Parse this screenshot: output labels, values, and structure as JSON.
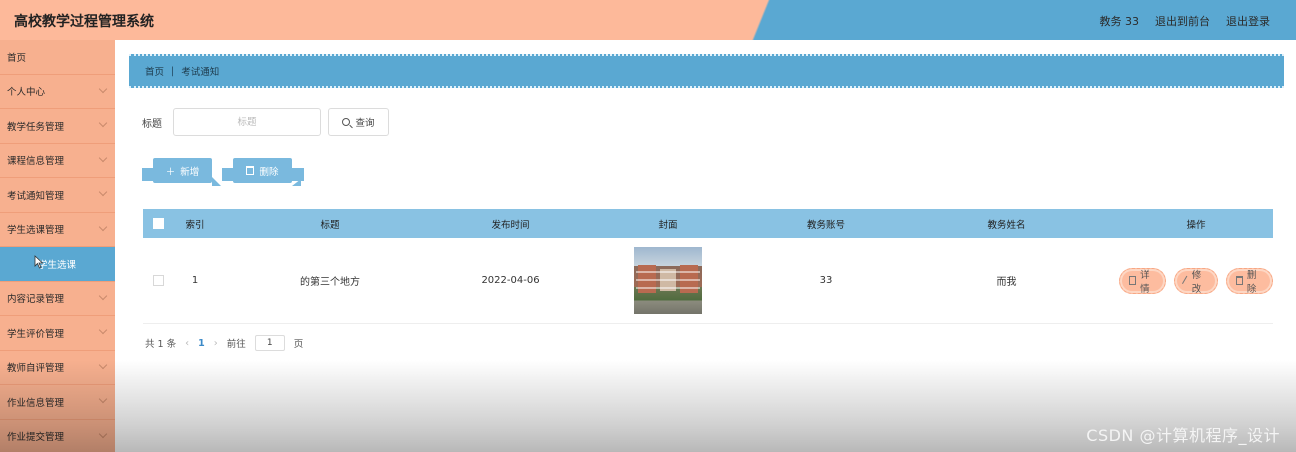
{
  "header": {
    "title": "高校教学过程管理系统",
    "user": "教务 33",
    "exit_front": "退出到前台",
    "logout": "退出登录"
  },
  "sidebar": {
    "items": [
      {
        "label": "首页",
        "chevron": false
      },
      {
        "label": "个人中心",
        "chevron": true
      },
      {
        "label": "教学任务管理",
        "chevron": true
      },
      {
        "label": "课程信息管理",
        "chevron": true
      },
      {
        "label": "考试通知管理",
        "chevron": true
      },
      {
        "label": "学生选课管理",
        "chevron": true
      },
      {
        "label": "学生选课",
        "chevron": false,
        "sub": true
      },
      {
        "label": "内容记录管理",
        "chevron": true
      },
      {
        "label": "学生评价管理",
        "chevron": true
      },
      {
        "label": "教师自评管理",
        "chevron": true
      },
      {
        "label": "作业信息管理",
        "chevron": true
      },
      {
        "label": "作业提交管理",
        "chevron": true
      }
    ]
  },
  "breadcrumb": {
    "home": "首页",
    "current": "考试通知"
  },
  "search": {
    "label": "标题",
    "placeholder": "标题",
    "query_label": "查询"
  },
  "actions": {
    "add_label": "新增",
    "delete_label": "删除"
  },
  "table": {
    "headers": [
      "索引",
      "标题",
      "发布时间",
      "封面",
      "教务账号",
      "教务姓名",
      "操作"
    ],
    "rows": [
      {
        "index": "1",
        "title": "的第三个地方",
        "time": "2022-04-06",
        "account": "33",
        "name": "而我"
      }
    ],
    "ops": {
      "detail": "详情",
      "edit": "修改",
      "delete": "删除"
    }
  },
  "pagination": {
    "total": "共 1 条",
    "current": "1",
    "goto": "前往",
    "page_value": "1",
    "page_unit": "页"
  },
  "watermark": "CSDN @计算机程序_设计",
  "colors": {
    "header_left": "#fdb99a",
    "header_right": "#5aa8d2",
    "sidebar": "#f7b08f",
    "table_head": "#89c2e3",
    "op_button": "#fdbc9f"
  }
}
